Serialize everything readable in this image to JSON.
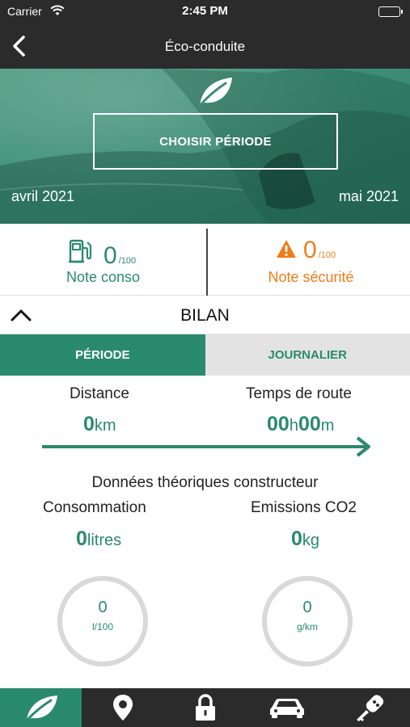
{
  "status_bar": {
    "carrier": "Carrier",
    "time": "2:45 PM"
  },
  "nav": {
    "title": "Éco-conduite",
    "back_icon": "chevron-left-icon"
  },
  "hero": {
    "icon": "leaf-icon",
    "choose_period_label": "CHOISIR PÉRIODE",
    "date_start": "avril 2021",
    "date_end": "mai 2021"
  },
  "scores": {
    "conso": {
      "value": "0",
      "max": "/100",
      "label": "Note conso",
      "icon": "fuel-pump-icon",
      "color": "#2a8a6d"
    },
    "securite": {
      "value": "0",
      "max": "/100",
      "label": "Note sécurité",
      "icon": "warning-icon",
      "color": "#f07c1a"
    }
  },
  "bilan": {
    "title": "BILAN",
    "toggle_icon": "chevron-up-icon"
  },
  "tabs": [
    {
      "label": "PÉRIODE",
      "active": true
    },
    {
      "label": "JOURNALIER",
      "active": false
    }
  ],
  "metrics": {
    "distance": {
      "label": "Distance",
      "value": "0",
      "unit": "km"
    },
    "temps": {
      "label": "Temps de route",
      "hours": "00",
      "h_unit": "h",
      "minutes": "00",
      "m_unit": "m"
    }
  },
  "theorique": {
    "title": "Données théoriques constructeur",
    "consommation": {
      "label": "Consommation",
      "value": "0",
      "unit": "litres",
      "gauge_value": "0",
      "gauge_unit": "l/100"
    },
    "co2": {
      "label": "Emissions CO2",
      "value": "0",
      "unit": "kg",
      "gauge_value": "0",
      "gauge_unit": "g/km"
    }
  },
  "tabbar": [
    {
      "icon": "leaf-icon",
      "active": true
    },
    {
      "icon": "map-pin-icon",
      "active": false
    },
    {
      "icon": "lock-icon",
      "active": false
    },
    {
      "icon": "car-icon",
      "active": false
    },
    {
      "icon": "car-key-icon",
      "active": false
    }
  ],
  "colors": {
    "accent": "#2a8a6d",
    "warning": "#f07c1a",
    "dark": "#2b2b2b"
  }
}
